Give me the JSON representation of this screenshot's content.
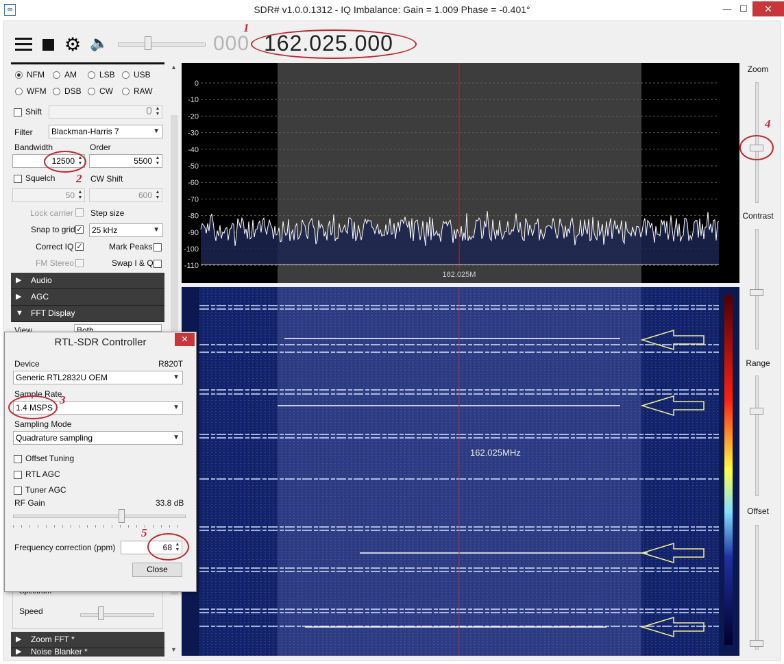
{
  "window": {
    "title": "SDR# v1.0.0.1312 - IQ Imbalance: Gain = 1.009 Phase = -0.401°",
    "app_icon": "sdr-logo",
    "controls": {
      "minimize": "—",
      "maximize": "☐",
      "close": "✕"
    }
  },
  "toolbar": {
    "icons": [
      "menu-icon",
      "stop-icon",
      "gear-icon",
      "speaker-icon"
    ],
    "volume": 0.33,
    "frequency_dim": "000",
    "frequency": "162.025.000"
  },
  "radio": {
    "modes": [
      {
        "label": "NFM",
        "selected": true
      },
      {
        "label": "AM",
        "selected": false
      },
      {
        "label": "LSB",
        "selected": false
      },
      {
        "label": "USB",
        "selected": false
      },
      {
        "label": "WFM",
        "selected": false
      },
      {
        "label": "DSB",
        "selected": false
      },
      {
        "label": "CW",
        "selected": false
      },
      {
        "label": "RAW",
        "selected": false
      }
    ],
    "shift_label": "Shift",
    "shift_value": "0",
    "filter_label": "Filter",
    "filter_value": "Blackman-Harris 7",
    "bandwidth_label": "Bandwidth",
    "bandwidth_value": "12500",
    "order_label": "Order",
    "order_value": "5500",
    "squelch_label": "Squelch",
    "squelch_value": "50",
    "cw_shift_label": "CW Shift",
    "cw_shift_value": "600",
    "lock_carrier_label": "Lock carrier",
    "step_size_label": "Step size",
    "snap_label": "Snap to grid",
    "snap_checked": true,
    "step_value": "25 kHz",
    "correct_iq_label": "Correct IQ",
    "correct_iq_checked": true,
    "mark_peaks_label": "Mark Peaks",
    "fm_stereo_label": "FM Stereo",
    "swap_iq_label": "Swap I & Q"
  },
  "sections": {
    "audio": "Audio",
    "agc": "AGC",
    "fft": "FFT Display",
    "fft_view_label": "View",
    "fft_view_value": "Both",
    "spectrum_label": "Spectrum",
    "speed_label": "Speed",
    "zoom_fft": "Zoom FFT *",
    "noise_blanker": "Noise Blanker *"
  },
  "spectrum": {
    "y_ticks": [
      "0",
      "-10",
      "-20",
      "-30",
      "-40",
      "-50",
      "-60",
      "-70",
      "-80",
      "-90",
      "-100",
      "-110"
    ],
    "center_label": "162.025M",
    "waterfall_label": "162.025MHz"
  },
  "sliders": {
    "zoom": "Zoom",
    "contrast": "Contrast",
    "range": "Range",
    "offset": "Offset"
  },
  "dialog": {
    "title": "RTL-SDR Controller",
    "close_icon": "✕",
    "device_label": "Device",
    "tuner": "R820T",
    "device_value": "Generic RTL2832U OEM",
    "sample_rate_label": "Sample Rate",
    "sample_rate_value": "1.4 MSPS",
    "sampling_mode_label": "Sampling Mode",
    "sampling_mode_value": "Quadrature sampling",
    "offset_tuning_label": "Offset Tuning",
    "rtl_agc_label": "RTL AGC",
    "tuner_agc_label": "Tuner AGC",
    "rf_gain_label": "RF Gain",
    "rf_gain_value": "33.8 dB",
    "freq_corr_label": "Frequency correction (ppm)",
    "freq_corr_value": "68",
    "close_button": "Close"
  },
  "annotations": [
    "1",
    "2",
    "3",
    "4",
    "5"
  ],
  "colors": {
    "annotation": "#c0282d",
    "spectrum_bg": "#000000",
    "waterfall_bg": "#0b1a4f",
    "section_bar": "#3c3c3c"
  }
}
